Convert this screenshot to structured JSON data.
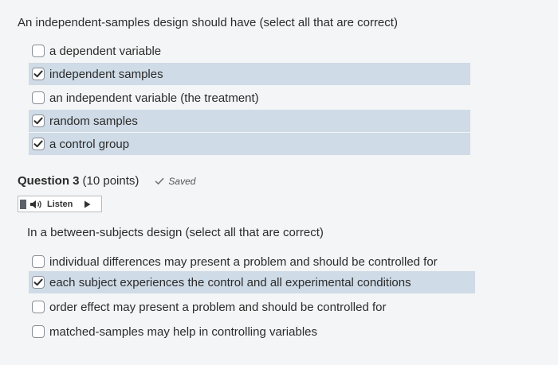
{
  "question2": {
    "prompt": "An independent-samples design should have (select all that are correct)",
    "options": [
      {
        "label": "a dependent variable",
        "checked": false
      },
      {
        "label": "independent samples",
        "checked": true
      },
      {
        "label": "an independent variable (the treatment)",
        "checked": false
      },
      {
        "label": "random samples",
        "checked": true
      },
      {
        "label": "a control group",
        "checked": true
      }
    ]
  },
  "question3": {
    "title": "Question 3",
    "points": "(10 points)",
    "saved_label": "Saved",
    "listen_label": "Listen",
    "prompt": "In a between-subjects design (select all that are correct)",
    "options": [
      {
        "label": "individual differences may present a problem and should be controlled for",
        "checked": false
      },
      {
        "label": "each subject experiences the control and all experimental conditions",
        "checked": true
      },
      {
        "label": "order effect may present a problem and should be controlled for",
        "checked": false
      },
      {
        "label": "matched-samples may help in controlling variables",
        "checked": false
      }
    ]
  },
  "colors": {
    "checked_row_bg": "#cfdbe6",
    "page_bg": "#f4f5f6",
    "check_mark": "#2b2b2b"
  }
}
